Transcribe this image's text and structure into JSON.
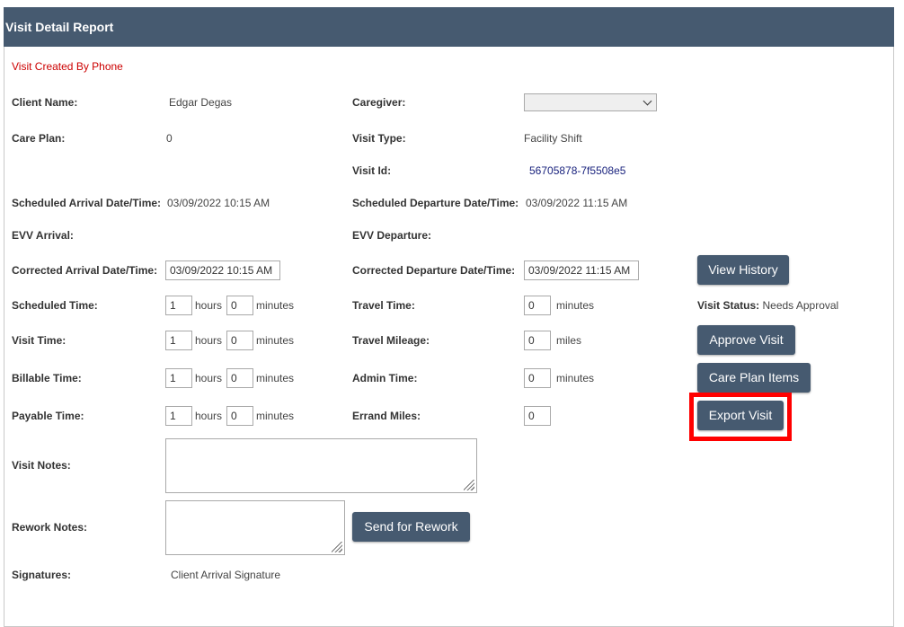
{
  "header": {
    "title": "Visit Detail Report"
  },
  "banner": {
    "text": "Visit Created By Phone"
  },
  "labels": {
    "client_name": "Client Name:",
    "caregiver": "Caregiver:",
    "care_plan": "Care Plan:",
    "visit_type": "Visit Type:",
    "visit_id": "Visit Id:",
    "scheduled_arrival": "Scheduled Arrival Date/Time:",
    "scheduled_departure": "Scheduled Departure Date/Time:",
    "evv_arrival": "EVV Arrival:",
    "evv_departure": "EVV Departure:",
    "corrected_arrival": "Corrected Arrival Date/Time:",
    "corrected_departure": "Corrected Departure Date/Time:",
    "scheduled_time": "Scheduled Time:",
    "travel_time": "Travel Time:",
    "visit_status": "Visit Status:",
    "visit_time": "Visit Time:",
    "travel_mileage": "Travel Mileage:",
    "billable_time": "Billable Time:",
    "admin_time": "Admin Time:",
    "payable_time": "Payable Time:",
    "errand_miles": "Errand Miles:",
    "visit_notes": "Visit Notes:",
    "rework_notes": "Rework Notes:",
    "signatures": "Signatures:"
  },
  "values": {
    "client_name": "Edgar Degas",
    "care_plan": "0",
    "visit_type": "Facility Shift",
    "visit_id": "56705878-7f5508e5",
    "scheduled_arrival": "03/09/2022 10:15 AM",
    "scheduled_departure": "03/09/2022 11:15 AM",
    "corrected_arrival": "03/09/2022 10:15 AM",
    "corrected_departure": "03/09/2022 11:15 AM",
    "visit_status": "Needs Approval",
    "signatures": "Client Arrival Signature"
  },
  "caregiver_select": {
    "value": ""
  },
  "units": {
    "hours": "hours",
    "minutes": "minutes",
    "miles": "miles"
  },
  "times": {
    "scheduled": {
      "hours": "1",
      "minutes": "0"
    },
    "visit": {
      "hours": "1",
      "minutes": "0"
    },
    "billable": {
      "hours": "1",
      "minutes": "0"
    },
    "payable": {
      "hours": "1",
      "minutes": "0"
    }
  },
  "fields": {
    "travel_time": "0",
    "travel_mileage": "0",
    "admin_time": "0",
    "errand_miles": "0",
    "visit_notes": "",
    "rework_notes": ""
  },
  "buttons": {
    "view_history": "View History",
    "approve_visit": "Approve Visit",
    "care_plan_items": "Care Plan Items",
    "export_visit": "Export Visit",
    "send_for_rework": "Send for Rework"
  },
  "colors": {
    "header_bg": "#465a70",
    "button_bg": "#465a70",
    "highlight": "#ff0000",
    "banner_text": "#cc0000",
    "visit_id_text": "#1a237e"
  }
}
